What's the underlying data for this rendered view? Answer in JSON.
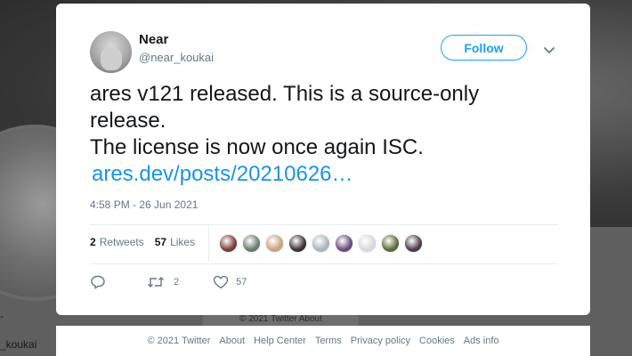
{
  "background": {
    "footer_dim_text": "© 2021 Twitter   About",
    "profile_handle_fragment": "_koukai",
    "dash": "-"
  },
  "tweet": {
    "author_name": "Near",
    "author_handle": "@near_koukai",
    "follow_label": "Follow",
    "text_lines": [
      "ares v121 released. This is a source-only",
      "release.",
      "The license is now once again ISC."
    ],
    "link_text": "ares.dev/posts/20210626…",
    "timestamp": "4:58 PM - 26 Jun 2021",
    "retweets_count": "2",
    "retweets_label": "Retweets",
    "likes_count": "57",
    "likes_label": "Likes",
    "action_retweet_count": "2",
    "action_like_count": "57",
    "likers": [
      {
        "icon": "liker-avatar-1",
        "color": "#7a3b3b"
      },
      {
        "icon": "liker-avatar-2",
        "color": "#6c7a6a"
      },
      {
        "icon": "liker-avatar-3",
        "color": "#c9a27e"
      },
      {
        "icon": "liker-avatar-4",
        "color": "#3a3030"
      },
      {
        "icon": "liker-avatar-5",
        "color": "#a9b3bc"
      },
      {
        "icon": "liker-avatar-6",
        "color": "#6b4a7a"
      },
      {
        "icon": "liker-avatar-7",
        "color": "#d8d8d8"
      },
      {
        "icon": "liker-avatar-8",
        "color": "#5a6b3a"
      },
      {
        "icon": "liker-avatar-9",
        "color": "#4a3a4a"
      }
    ]
  },
  "footer": {
    "links": [
      "© 2021 Twitter",
      "About",
      "Help Center",
      "Terms",
      "Privacy policy",
      "Cookies",
      "Ads info"
    ]
  },
  "colors": {
    "accent": "#1da1f2",
    "link": "#1b95e0",
    "muted": "#657786",
    "text": "#14171a"
  }
}
